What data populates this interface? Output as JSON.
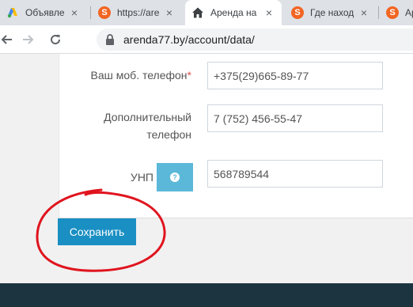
{
  "tabs": [
    {
      "title": "Объявлени",
      "icon": "google-ads-icon"
    },
    {
      "title": "https://are",
      "icon": "s-logo-icon"
    },
    {
      "title": "Аренда на",
      "icon": "home-icon",
      "active": true
    },
    {
      "title": "Где находи",
      "icon": "s-logo-icon"
    },
    {
      "title": "Ар",
      "icon": "s-logo-icon"
    }
  ],
  "favicon_letter": "S",
  "close_glyph": "×",
  "address_bar": {
    "url": "arenda77.by/account/data/"
  },
  "form": {
    "mobile_label": "Ваш моб. телефон",
    "required_mark": "*",
    "mobile_value": "+375(29)665-89-77",
    "additional_label_line1": "Дополнительный",
    "additional_label_line2": "телефон",
    "additional_value": "7 (752) 456-55-47",
    "unp_label": "УНП",
    "help_glyph": "?",
    "unp_value": "568789544",
    "save_label": "Сохранить"
  },
  "colors": {
    "accent": "#1a8fc3",
    "help_button": "#5bb8d8",
    "footer": "#1c3440",
    "annotation": "#e0141e",
    "required": "#d9534f"
  }
}
